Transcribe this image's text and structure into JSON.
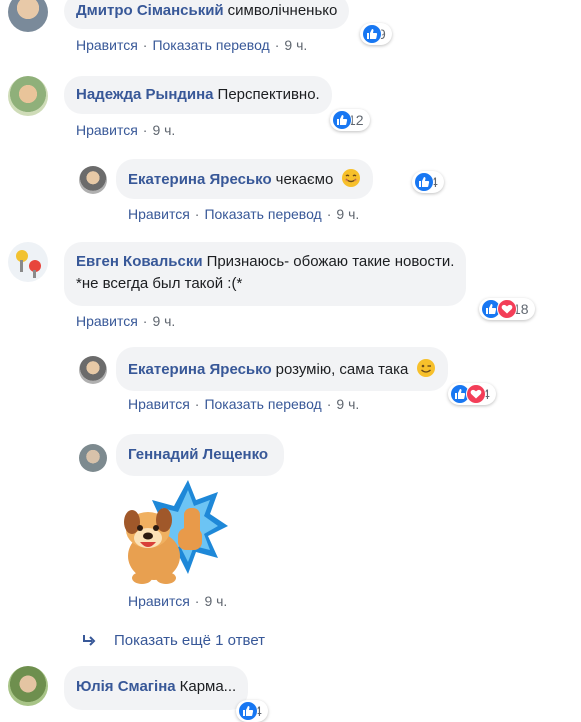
{
  "actions": {
    "like": "Нравится",
    "translate": "Показать перевод",
    "time": "9 ч."
  },
  "comments": [
    {
      "author": "Дмитро Сіманський",
      "text": "символічненько",
      "reactions": "9"
    },
    {
      "author": "Надежда Рындина",
      "text": "Перспективно.",
      "reactions": "12"
    },
    {
      "author": "Екатерина Яресько",
      "text": "чекаємо",
      "reactions": "4"
    },
    {
      "author": "Евген Ковальски",
      "text": "Признаюсь- обожаю такие новости.",
      "text2": "*не всегда был такой :(*",
      "reactions": "18"
    },
    {
      "author": "Екатерина Яресько",
      "text": "розумію, сама така",
      "reactions": "4"
    },
    {
      "author": "Геннадий Лещенко"
    },
    {
      "author": "Юлія Смагіна",
      "text": "Карма...",
      "reactions": "4"
    }
  ],
  "more_replies": "Показать ещё 1 ответ",
  "colors": {
    "link": "#385898",
    "like": "#1877f2",
    "love": "#f33e58",
    "bubble": "#f2f3f5"
  }
}
